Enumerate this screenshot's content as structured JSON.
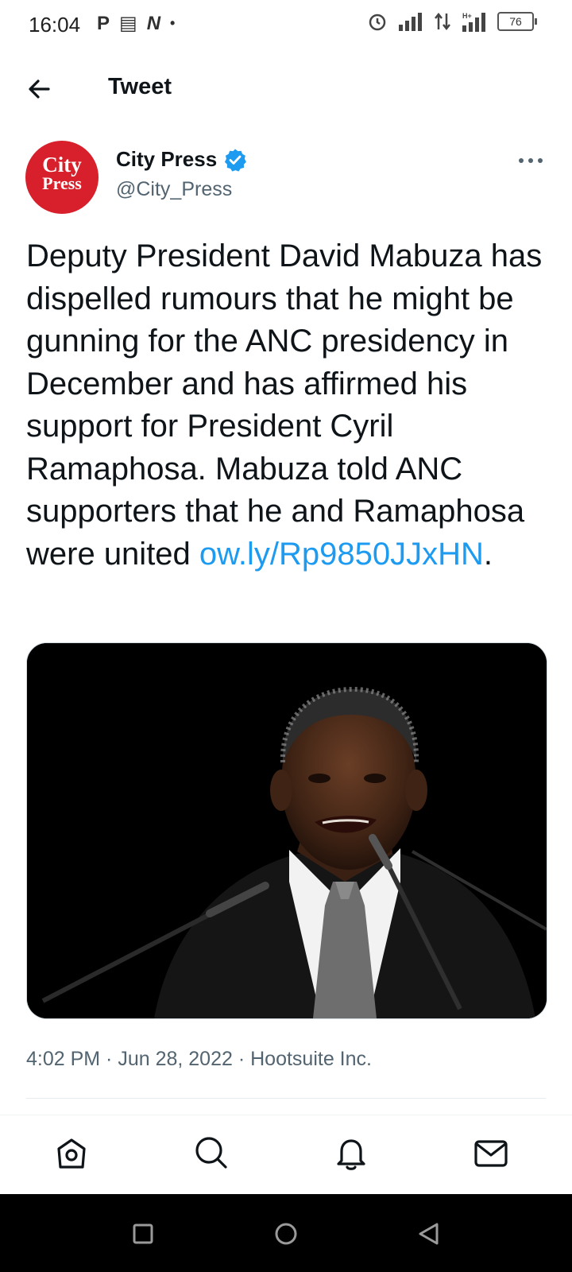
{
  "status_bar": {
    "time": "16:04",
    "left_icons": [
      "P",
      "▤",
      "N",
      "•"
    ],
    "battery": "76"
  },
  "header": {
    "title": "Tweet"
  },
  "tweet": {
    "author": {
      "avatar_line1": "City",
      "avatar_line2": "Press",
      "name": "City Press",
      "handle": "@City_Press",
      "verified": true,
      "avatar_color": "#d7202b"
    },
    "text": "Deputy President David Mabuza has dispelled rumours that he might be gunning for the ANC presidency in December and has affirmed his support for President Cyril Ramaphosa. Mabuza told ANC supporters that he and Ramaphosa were united ",
    "link": "ow.ly/Rp9850JJxHN",
    "text_end": ".",
    "meta": "4:02 PM · Jun 28, 2022 · Hootsuite Inc."
  },
  "bottom_nav": {
    "items": [
      "home-icon",
      "search-icon",
      "notifications-icon",
      "messages-icon"
    ]
  },
  "system_nav": {
    "items": [
      "recents-icon",
      "home-circle-icon",
      "back-triangle-icon"
    ]
  },
  "colors": {
    "link": "#1d9bf0",
    "verified": "#1d9bf0",
    "secondary_text": "#536471"
  }
}
